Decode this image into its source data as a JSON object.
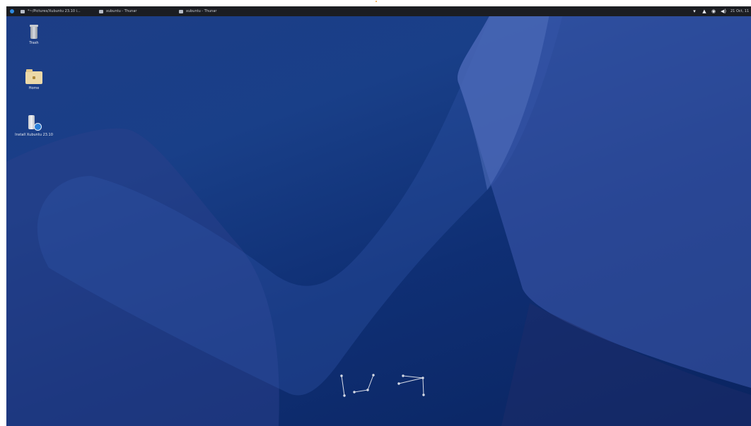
{
  "panel": {
    "tasks": [
      {
        "label": "*~/Pictures/Xubuntu 23.10 i..."
      },
      {
        "label": "xubuntu - Thunar"
      },
      {
        "label": "xubuntu - Thunar"
      }
    ],
    "clock": "21 Oct, 11"
  },
  "desktop": {
    "icons": [
      {
        "label": "Trash"
      },
      {
        "label": "Home"
      },
      {
        "label": "Install Xubuntu 23.10"
      }
    ]
  },
  "colors": {
    "panel_bg": "#1b1d22",
    "wallpaper_top": "#1d3d86",
    "wallpaper_bottom": "#0a2460",
    "accent": "#2a7fd8"
  },
  "icons": {
    "menu": "xubuntu-menu-icon",
    "wifi": "wifi-icon",
    "notifications": "bell-icon",
    "power": "power-icon",
    "volume": "volume-icon"
  }
}
